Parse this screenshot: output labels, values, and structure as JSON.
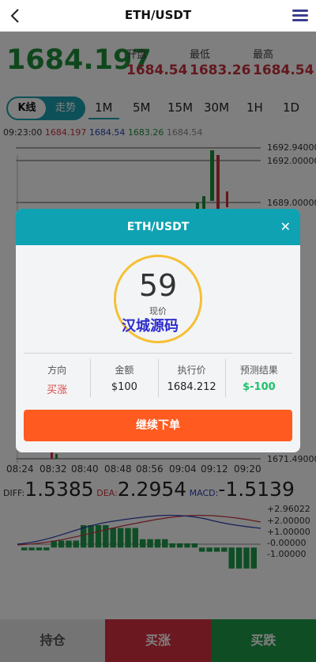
{
  "header": {
    "title": "ETH/USDT"
  },
  "price": {
    "current": "1684.197",
    "stats": [
      {
        "label": "开盘",
        "value": "1684.54"
      },
      {
        "label": "最低",
        "value": "1683.26"
      },
      {
        "label": "最高",
        "value": "1684.54"
      }
    ]
  },
  "tabs": {
    "chart_type": [
      "K线",
      "走势"
    ],
    "intervals": [
      "1M",
      "5M",
      "15M",
      "30M",
      "1H",
      "1D"
    ]
  },
  "ohlc_line": {
    "time": "09:23:00",
    "values": [
      "1684.197",
      "1684.54",
      "1683.26",
      "1684.54"
    ]
  },
  "price_axis": [
    "1692.94000",
    "1692.00000",
    "1689.00000",
    "1671.49000"
  ],
  "time_axis": [
    "08:24",
    "08:32",
    "08:40",
    "08:48",
    "08:56",
    "09:04",
    "09:12",
    "09:20"
  ],
  "macd": {
    "diff_label": "DIFF:",
    "diff_value": "1.5385",
    "dea_label": "DEA:",
    "dea_value": "2.2954",
    "macd_label": "MACD:",
    "macd_value": "-1.5139",
    "axis": [
      "+2.96022",
      "+2.00000",
      "+1.00000",
      "-0.00000",
      "-1.00000"
    ]
  },
  "bottom": {
    "hold": "持仓",
    "buy_up": "买涨",
    "buy_down": "买跌"
  },
  "modal": {
    "title": "ETH/USDT",
    "close": "✕",
    "countdown": "59",
    "countdown_label": "现价",
    "watermark": "汉城源码",
    "cells": [
      {
        "label": "方向",
        "value": "买涨"
      },
      {
        "label": "金额",
        "value": "$100"
      },
      {
        "label": "执行价",
        "value": "1684.212"
      },
      {
        "label": "预测结果",
        "value": "$-100"
      }
    ],
    "continue_button": "继续下单"
  },
  "colors": {
    "accent": "#0fa2b3",
    "up": "#d93040",
    "down": "#1f9b4a",
    "price_green": "#1f8f3a",
    "stat_red": "#c8303d",
    "ring": "#f6c035",
    "cta": "#ff5a1f"
  },
  "chart_data": {
    "type": "bar",
    "title": "",
    "categories": [
      "08:24",
      "08:32",
      "08:40",
      "08:48",
      "08:56",
      "09:04",
      "09:12",
      "09:20"
    ],
    "series": [
      {
        "values": [
          -0.2,
          0.5,
          1.6,
          1.4,
          0.6,
          0.3,
          -0.3,
          -1.5
        ]
      }
    ],
    "ylim": [
      -1.0,
      2.96022
    ],
    "grid": false
  }
}
